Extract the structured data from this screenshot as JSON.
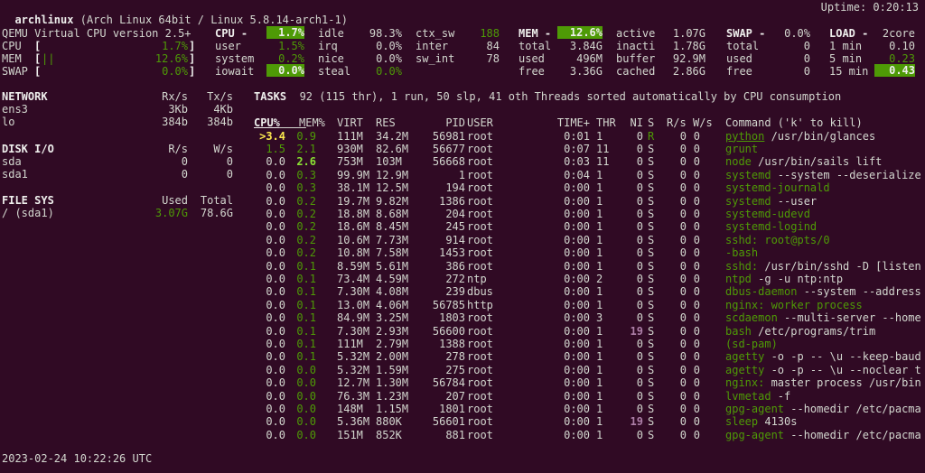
{
  "header": {
    "hostname": "archlinux",
    "system": "(Arch Linux 64bit / Linux 5.8.14-arch1-1)",
    "uptime": "Uptime: 0:20:13"
  },
  "quicklook": {
    "cpu_name": "QEMU Virtual CPU version 2.5+",
    "rows": [
      {
        "label": "CPU",
        "bar": "",
        "value": "1.7%",
        "fraction": 0.017
      },
      {
        "label": "MEM",
        "bar": "||",
        "value": "12.6%",
        "fraction": 0.126
      },
      {
        "label": "SWAP",
        "bar": "",
        "value": "0.0%",
        "fraction": 0.0
      }
    ]
  },
  "cpu": {
    "title": "CPU",
    "total": "1.7%",
    "user_label": "user",
    "user": "1.5%",
    "system_label": "system",
    "system": "0.2%",
    "iowait_label": "iowait",
    "iowait": "0.0%",
    "idle_label": "idle",
    "idle": "98.3%",
    "irq_label": "irq",
    "irq": "0.0%",
    "nice_label": "nice",
    "nice": "0.0%",
    "steal_label": "steal",
    "steal": "0.0%",
    "ctx_sw_label": "ctx_sw",
    "ctx_sw": "188",
    "inter_label": "inter",
    "inter": "84",
    "sw_int_label": "sw_int",
    "sw_int": "78"
  },
  "mem": {
    "title": "MEM",
    "percent": "12.6%",
    "total_label": "total",
    "total": "3.84G",
    "used_label": "used",
    "used": "496M",
    "free_label": "free",
    "free": "3.36G",
    "active_label": "active",
    "active": "1.07G",
    "inacti_label": "inacti",
    "inacti": "1.78G",
    "buffer_label": "buffer",
    "buffer": "92.9M",
    "cached_label": "cached",
    "cached": "2.86G"
  },
  "swap": {
    "title": "SWAP",
    "percent": "0.0%",
    "total_label": "total",
    "total": "0",
    "used_label": "used",
    "used": "0",
    "free_label": "free",
    "free": "0"
  },
  "load": {
    "title": "LOAD",
    "cores": "2core",
    "min1_label": "1 min",
    "min1": "0.10",
    "min5_label": "5 min",
    "min5": "0.23",
    "min15_label": "15 min",
    "min15": "0.43"
  },
  "network": {
    "title": "NETWORK",
    "rx_header": "Rx/s",
    "tx_header": "Tx/s",
    "interfaces": [
      {
        "name": "ens3",
        "rx": "3Kb",
        "tx": "4Kb"
      },
      {
        "name": "lo",
        "rx": "384b",
        "tx": "384b"
      }
    ]
  },
  "diskio": {
    "title": "DISK I/O",
    "r_header": "R/s",
    "w_header": "W/s",
    "disks": [
      {
        "name": "sda",
        "r": "0",
        "w": "0"
      },
      {
        "name": "sda1",
        "r": "0",
        "w": "0"
      }
    ]
  },
  "filesys": {
    "title": "FILE SYS",
    "used_header": "Used",
    "total_header": "Total",
    "mounts": [
      {
        "name": "/ (sda1)",
        "used": "3.07G",
        "total": "78.6G"
      }
    ]
  },
  "tasks": {
    "title": "TASKS",
    "summary": "92 (115 thr), 1 run, 50 slp, 41 oth Threads sorted automatically by CPU consumption"
  },
  "process_table": {
    "headers": {
      "cpu": "CPU%",
      "mem": "MEM%",
      "virt": "VIRT",
      "res": "RES",
      "pid": "PID",
      "user": "USER",
      "time": "TIME+",
      "thr": "THR",
      "ni": "NI",
      "s": "S",
      "rs": "R/s",
      "ws": "W/s",
      "command": "Command ('k' to kill)"
    },
    "rows": [
      {
        "cpu": ">3.4",
        "mem": "0.9",
        "virt": "111M",
        "res": "34.2M",
        "pid": "56981",
        "user": "root",
        "time": "0:01",
        "thr": "1",
        "ni": "0",
        "s": "R",
        "rs": "0",
        "ws": "0",
        "cmd": "python",
        "args": " /usr/bin/glances"
      },
      {
        "cpu": "1.5",
        "mem": "2.1",
        "virt": "930M",
        "res": "82.6M",
        "pid": "56677",
        "user": "root",
        "time": "0:07",
        "thr": "11",
        "ni": "0",
        "s": "S",
        "rs": "0",
        "ws": "0",
        "cmd": "grunt",
        "args": ""
      },
      {
        "cpu": "0.0",
        "mem": "2.6",
        "virt": "753M",
        "res": "103M",
        "pid": "56668",
        "user": "root",
        "time": "0:03",
        "thr": "11",
        "ni": "0",
        "s": "S",
        "rs": "0",
        "ws": "0",
        "cmd": "node",
        "args": " /usr/bin/sails lift"
      },
      {
        "cpu": "0.0",
        "mem": "0.3",
        "virt": "99.9M",
        "res": "12.9M",
        "pid": "1",
        "user": "root",
        "time": "0:04",
        "thr": "1",
        "ni": "0",
        "s": "S",
        "rs": "0",
        "ws": "0",
        "cmd": "systemd",
        "args": " --system --deserialize"
      },
      {
        "cpu": "0.0",
        "mem": "0.3",
        "virt": "38.1M",
        "res": "12.5M",
        "pid": "194",
        "user": "root",
        "time": "0:00",
        "thr": "1",
        "ni": "0",
        "s": "S",
        "rs": "0",
        "ws": "0",
        "cmd": "systemd-journald",
        "args": ""
      },
      {
        "cpu": "0.0",
        "mem": "0.2",
        "virt": "19.7M",
        "res": "9.82M",
        "pid": "1386",
        "user": "root",
        "time": "0:00",
        "thr": "1",
        "ni": "0",
        "s": "S",
        "rs": "0",
        "ws": "0",
        "cmd": "systemd",
        "args": " --user"
      },
      {
        "cpu": "0.0",
        "mem": "0.2",
        "virt": "18.8M",
        "res": "8.68M",
        "pid": "204",
        "user": "root",
        "time": "0:00",
        "thr": "1",
        "ni": "0",
        "s": "S",
        "rs": "0",
        "ws": "0",
        "cmd": "systemd-udevd",
        "args": ""
      },
      {
        "cpu": "0.0",
        "mem": "0.2",
        "virt": "18.6M",
        "res": "8.45M",
        "pid": "245",
        "user": "root",
        "time": "0:00",
        "thr": "1",
        "ni": "0",
        "s": "S",
        "rs": "0",
        "ws": "0",
        "cmd": "systemd-logind",
        "args": ""
      },
      {
        "cpu": "0.0",
        "mem": "0.2",
        "virt": "10.6M",
        "res": "7.73M",
        "pid": "914",
        "user": "root",
        "time": "0:00",
        "thr": "1",
        "ni": "0",
        "s": "S",
        "rs": "0",
        "ws": "0",
        "cmd": "sshd: root@pts/0",
        "args": ""
      },
      {
        "cpu": "0.0",
        "mem": "0.2",
        "virt": "10.8M",
        "res": "7.58M",
        "pid": "1453",
        "user": "root",
        "time": "0:00",
        "thr": "1",
        "ni": "0",
        "s": "S",
        "rs": "0",
        "ws": "0",
        "cmd": "-bash",
        "args": ""
      },
      {
        "cpu": "0.0",
        "mem": "0.1",
        "virt": "8.59M",
        "res": "5.61M",
        "pid": "386",
        "user": "root",
        "time": "0:00",
        "thr": "1",
        "ni": "0",
        "s": "S",
        "rs": "0",
        "ws": "0",
        "cmd": "sshd:",
        "args": " /usr/bin/sshd -D [listen"
      },
      {
        "cpu": "0.0",
        "mem": "0.1",
        "virt": "73.4M",
        "res": "4.59M",
        "pid": "272",
        "user": "ntp",
        "time": "0:00",
        "thr": "2",
        "ni": "0",
        "s": "S",
        "rs": "0",
        "ws": "0",
        "cmd": "ntpd",
        "args": " -g -u ntp:ntp"
      },
      {
        "cpu": "0.0",
        "mem": "0.1",
        "virt": "7.30M",
        "res": "4.08M",
        "pid": "239",
        "user": "dbus",
        "time": "0:00",
        "thr": "1",
        "ni": "0",
        "s": "S",
        "rs": "0",
        "ws": "0",
        "cmd": "dbus-daemon",
        "args": " --system --address"
      },
      {
        "cpu": "0.0",
        "mem": "0.1",
        "virt": "13.0M",
        "res": "4.06M",
        "pid": "56785",
        "user": "http",
        "time": "0:00",
        "thr": "1",
        "ni": "0",
        "s": "S",
        "rs": "0",
        "ws": "0",
        "cmd": "nginx: worker process",
        "args": ""
      },
      {
        "cpu": "0.0",
        "mem": "0.1",
        "virt": "84.9M",
        "res": "3.25M",
        "pid": "1803",
        "user": "root",
        "time": "0:00",
        "thr": "3",
        "ni": "0",
        "s": "S",
        "rs": "0",
        "ws": "0",
        "cmd": "scdaemon",
        "args": " --multi-server --home"
      },
      {
        "cpu": "0.0",
        "mem": "0.1",
        "virt": "7.30M",
        "res": "2.93M",
        "pid": "56600",
        "user": "root",
        "time": "0:00",
        "thr": "1",
        "ni": "19",
        "s": "S",
        "rs": "0",
        "ws": "0",
        "cmd": "bash",
        "args": " /etc/programs/trim"
      },
      {
        "cpu": "0.0",
        "mem": "0.1",
        "virt": "111M",
        "res": "2.79M",
        "pid": "1388",
        "user": "root",
        "time": "0:00",
        "thr": "1",
        "ni": "0",
        "s": "S",
        "rs": "0",
        "ws": "0",
        "cmd": "(sd-pam)",
        "args": ""
      },
      {
        "cpu": "0.0",
        "mem": "0.1",
        "virt": "5.32M",
        "res": "2.00M",
        "pid": "278",
        "user": "root",
        "time": "0:00",
        "thr": "1",
        "ni": "0",
        "s": "S",
        "rs": "0",
        "ws": "0",
        "cmd": "agetty",
        "args": " -o -p -- \\u --keep-baud"
      },
      {
        "cpu": "0.0",
        "mem": "0.0",
        "virt": "5.32M",
        "res": "1.59M",
        "pid": "275",
        "user": "root",
        "time": "0:00",
        "thr": "1",
        "ni": "0",
        "s": "S",
        "rs": "0",
        "ws": "0",
        "cmd": "agetty",
        "args": " -o -p -- \\u --noclear t"
      },
      {
        "cpu": "0.0",
        "mem": "0.0",
        "virt": "12.7M",
        "res": "1.30M",
        "pid": "56784",
        "user": "root",
        "time": "0:00",
        "thr": "1",
        "ni": "0",
        "s": "S",
        "rs": "0",
        "ws": "0",
        "cmd": "nginx:",
        "args": " master process /usr/bin"
      },
      {
        "cpu": "0.0",
        "mem": "0.0",
        "virt": "76.3M",
        "res": "1.23M",
        "pid": "207",
        "user": "root",
        "time": "0:00",
        "thr": "1",
        "ni": "0",
        "s": "S",
        "rs": "0",
        "ws": "0",
        "cmd": "lvmetad",
        "args": " -f"
      },
      {
        "cpu": "0.0",
        "mem": "0.0",
        "virt": "148M",
        "res": "1.15M",
        "pid": "1801",
        "user": "root",
        "time": "0:00",
        "thr": "1",
        "ni": "0",
        "s": "S",
        "rs": "0",
        "ws": "0",
        "cmd": "gpg-agent",
        "args": " --homedir /etc/pacma"
      },
      {
        "cpu": "0.0",
        "mem": "0.0",
        "virt": "5.36M",
        "res": "880K",
        "pid": "56601",
        "user": "root",
        "time": "0:00",
        "thr": "1",
        "ni": "19",
        "s": "S",
        "rs": "0",
        "ws": "0",
        "cmd": "sleep",
        "args": " 4130s"
      },
      {
        "cpu": "0.0",
        "mem": "0.0",
        "virt": "151M",
        "res": "852K",
        "pid": "881",
        "user": "root",
        "time": "0:00",
        "thr": "1",
        "ni": "0",
        "s": "S",
        "rs": "0",
        "ws": "0",
        "cmd": "gpg-agent",
        "args": " --homedir /etc/pacma"
      }
    ]
  },
  "footer": {
    "datetime": "2023-02-24 10:22:26 UTC"
  },
  "colors": {
    "background": "#300a24",
    "text": "#d3d7cf",
    "ok_green": "#4e9a06",
    "highlight_bg": "#4e9a06",
    "nice_magenta": "#ad7fa8",
    "cursor_yellow": "#fce94f"
  }
}
